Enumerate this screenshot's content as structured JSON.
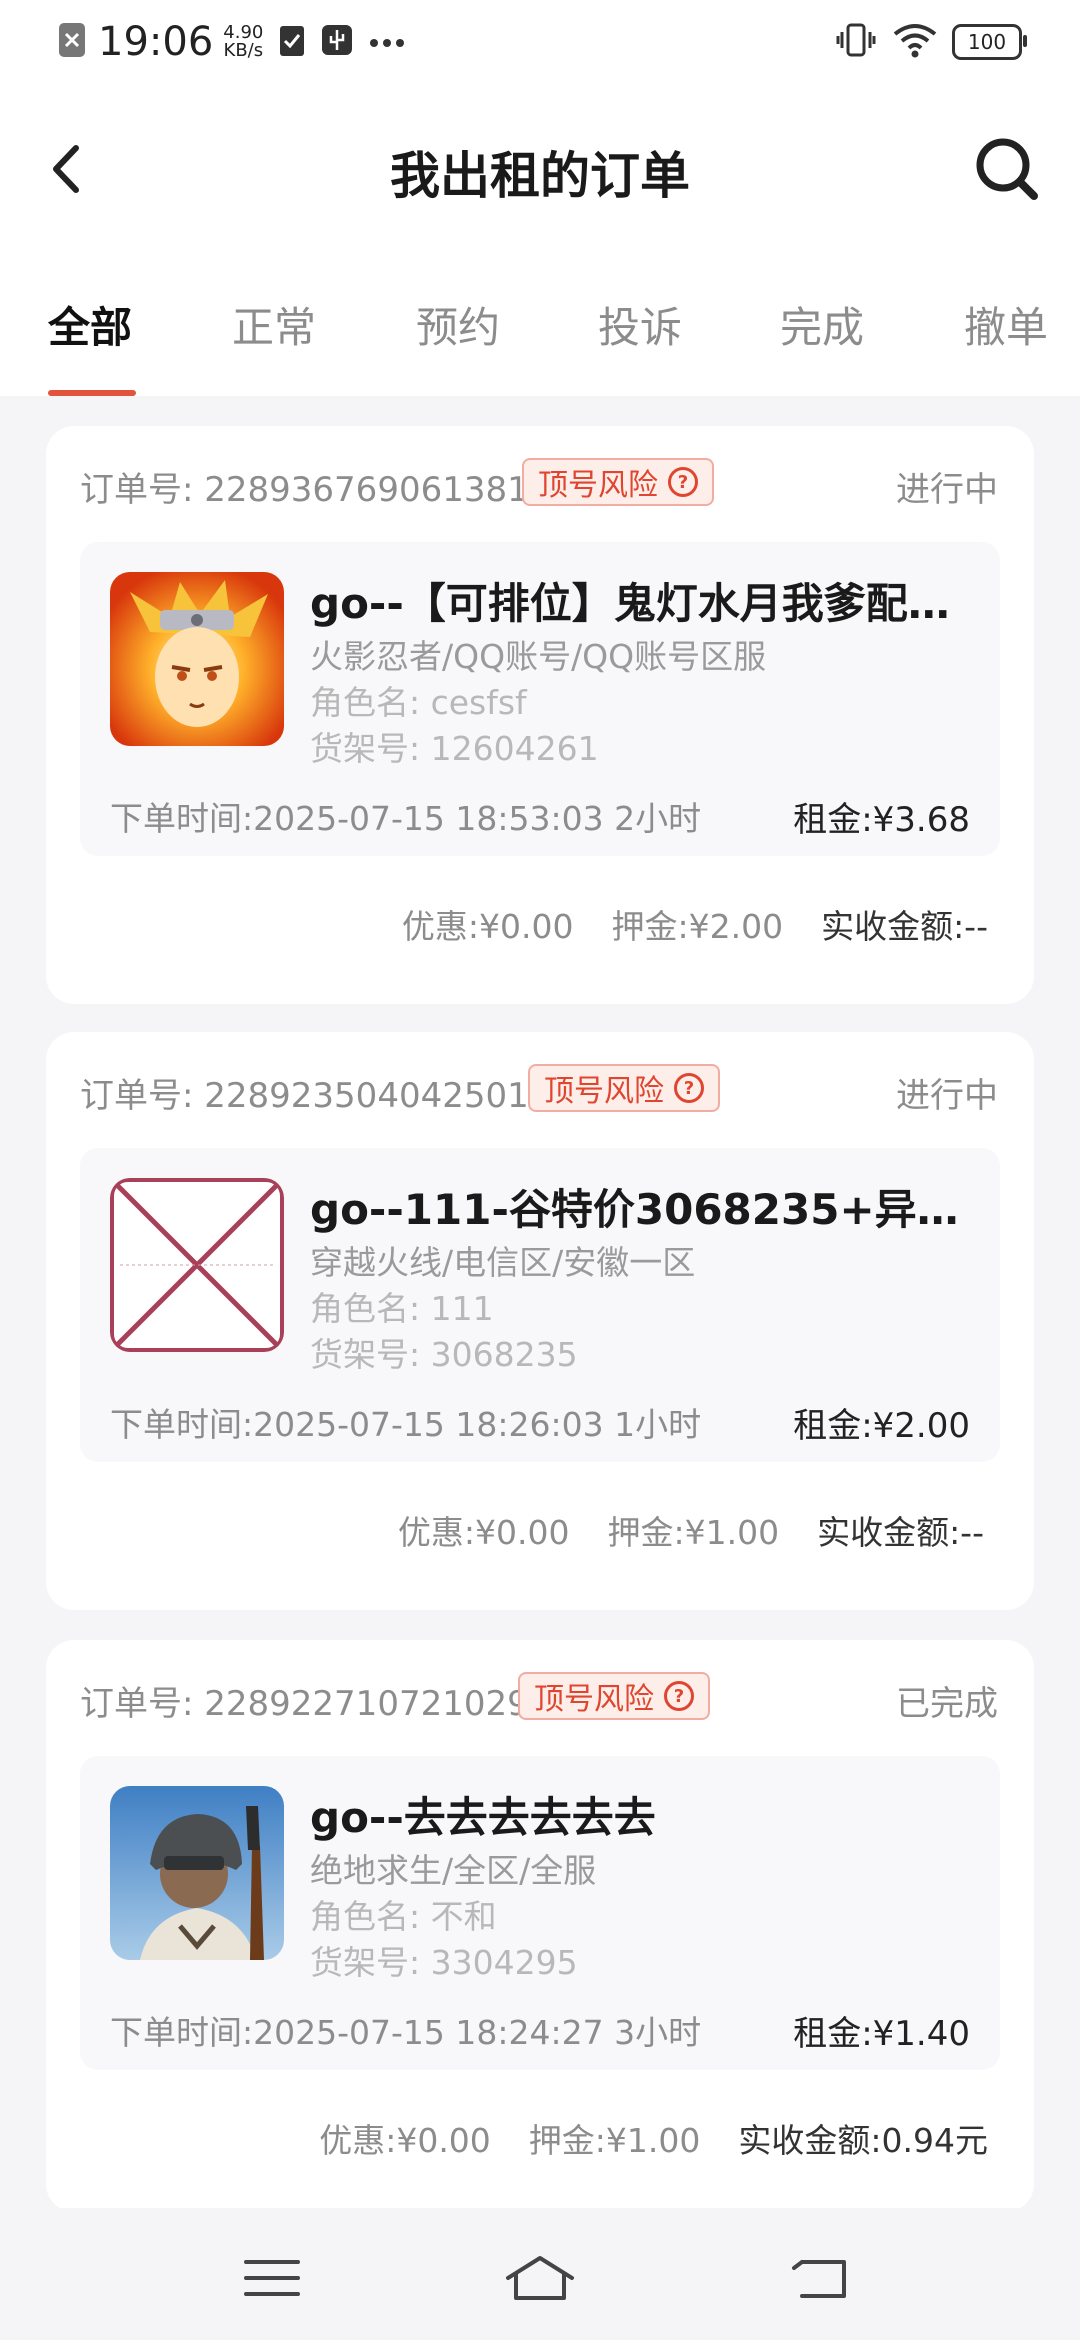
{
  "status_bar": {
    "time": "19:06",
    "speed_value": "4.90",
    "speed_unit": "KB/s",
    "battery": "100"
  },
  "header": {
    "title": "我出租的订单"
  },
  "tabs": [
    "全部",
    "正常",
    "预约",
    "投诉",
    "完成",
    "撤单"
  ],
  "active_tab": "全部",
  "orders": [
    {
      "order_no": "订单号: 228936769061381",
      "badge": "顶号风险",
      "status": "进行中",
      "thumb_icon": "naruto-game-icon",
      "title": "go--【可排位】鬼灯水月我爹配…",
      "line1": "火影忍者/QQ账号/QQ账号区服",
      "line2": "角色名: cesfsf",
      "line3": "货架号: 12604261",
      "order_time": "下单时间:2025-07-15 18:53:03  2小时",
      "rent": "租金:¥3.68",
      "discount": "优惠:¥0.00",
      "deposit": "押金:¥2.00",
      "received": "实收金额:--"
    },
    {
      "order_no": "订单号: 228923504042501",
      "badge": "顶号风险",
      "status": "进行中",
      "thumb_icon": "broken-image-icon",
      "title": "go--111-谷特价3068235+异常…",
      "line1": "穿越火线/电信区/安徽一区",
      "line2": "角色名: 111",
      "line3": "货架号: 3068235",
      "order_time": "下单时间:2025-07-15 18:26:03  1小时",
      "rent": "租金:¥2.00",
      "discount": "优惠:¥0.00",
      "deposit": "押金:¥1.00",
      "received": "实收金额:--"
    },
    {
      "order_no": "订单号: 228922710721029",
      "badge": "顶号风险",
      "status": "已完成",
      "thumb_icon": "pubg-soldier-icon",
      "title": "go--去去去去去去",
      "line1": "绝地求生/全区/全服",
      "line2": "角色名: 不和",
      "line3": "货架号: 3304295",
      "order_time": "下单时间:2025-07-15 18:24:27  3小时",
      "rent": "租金:¥1.40",
      "discount": "优惠:¥0.00",
      "deposit": "押金:¥1.00",
      "received": "实收金额:0.94元"
    }
  ],
  "colors": {
    "accent": "#e3523c",
    "badge_red": "#e0462f",
    "muted": "#8c8c8c"
  }
}
